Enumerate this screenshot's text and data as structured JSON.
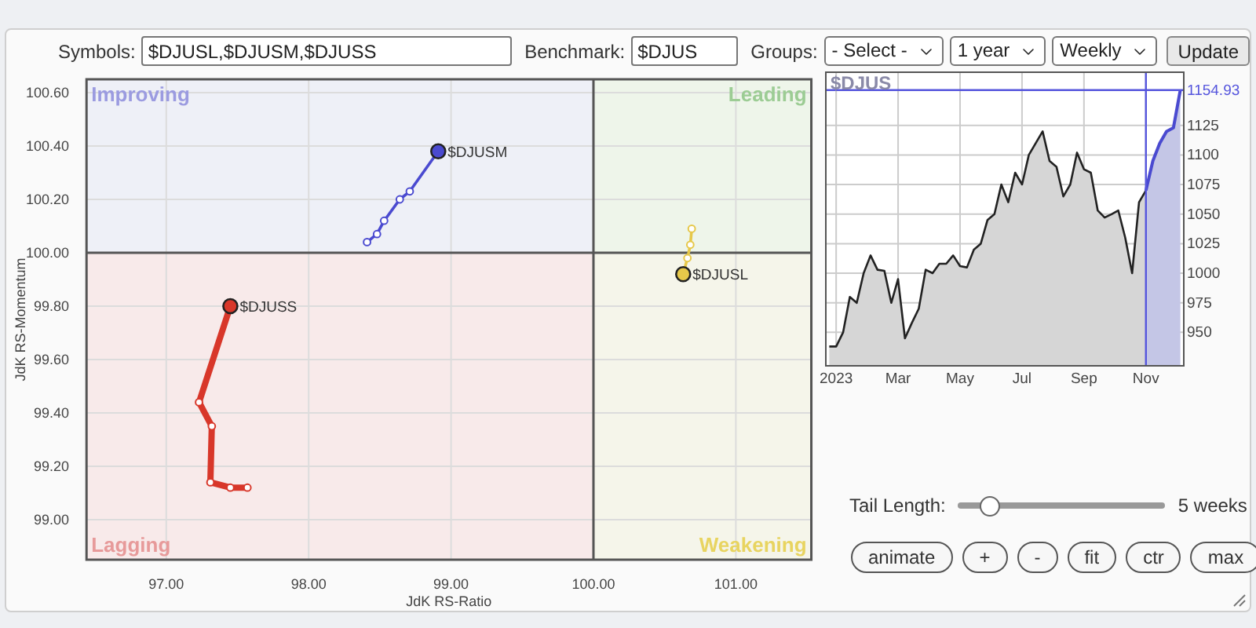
{
  "toolbar": {
    "symbols_label": "Symbols:",
    "symbols_value": "$DJUSL,$DJUSM,$DJUSS",
    "benchmark_label": "Benchmark:",
    "benchmark_value": "$DJUS",
    "groups_label": "Groups:",
    "selects": [
      "- Select -",
      "1 year",
      "Weekly"
    ],
    "update_button": "Update"
  },
  "rrg": {
    "quadrants": [
      {
        "label": "Improving",
        "color": "#9b9be0"
      },
      {
        "label": "Leading",
        "color": "#9ccc94"
      },
      {
        "label": "Lagging",
        "color": "#e79a9a"
      },
      {
        "label": "Weakening",
        "color": "#e8d460"
      }
    ],
    "chart_data": {
      "type": "line",
      "grid": true,
      "xlabel": "JdK RS-Ratio",
      "ylabel": "JdK RS-Momentum",
      "xlim": [
        96.44,
        101.53
      ],
      "ylim": [
        98.85,
        100.65
      ],
      "xticks": [
        {
          "value": 97,
          "label": "97.00"
        },
        {
          "value": 98,
          "label": "98.00"
        },
        {
          "value": 99,
          "label": "99.00"
        },
        {
          "value": 100,
          "label": "100.00"
        },
        {
          "value": 101,
          "label": "101.00"
        }
      ],
      "yticks": [
        {
          "value": 99,
          "label": "99.00"
        },
        {
          "value": 99.2,
          "label": "99.20"
        },
        {
          "value": 99.4,
          "label": "99.40"
        },
        {
          "value": 99.6,
          "label": "99.60"
        },
        {
          "value": 99.8,
          "label": "99.80"
        },
        {
          "value": 100,
          "label": "100.00"
        },
        {
          "value": 100.2,
          "label": "100.20"
        },
        {
          "value": 100.4,
          "label": "100.40"
        },
        {
          "value": 100.6,
          "label": "100.60"
        }
      ],
      "series": [
        {
          "name": "$DJUSL",
          "color": "#e6c84a",
          "marker": "circle",
          "x": [
            100.69,
            100.68,
            100.66,
            100.63
          ],
          "values": [
            100.09,
            100.03,
            99.98,
            99.92
          ]
        },
        {
          "name": "$DJUSM",
          "color": "#4a4ad0",
          "marker": "circle",
          "x": [
            98.41,
            98.48,
            98.53,
            98.64,
            98.71,
            98.91
          ],
          "values": [
            100.04,
            100.07,
            100.12,
            100.2,
            100.23,
            100.38
          ]
        },
        {
          "name": "$DJUSS",
          "color": "#d8372a",
          "marker": "circle",
          "x": [
            97.57,
            97.45,
            97.31,
            97.32,
            97.23,
            97.45
          ],
          "values": [
            99.12,
            99.12,
            99.14,
            99.35,
            99.44,
            99.8
          ]
        }
      ]
    }
  },
  "benchmark_chart": {
    "chart_data": {
      "type": "area",
      "title": "$DJUS",
      "grid": true,
      "ylim": [
        921.7,
        1170
      ],
      "yticks": [
        950,
        975,
        1000,
        1025,
        1050,
        1075,
        1100,
        1125
      ],
      "categories": [
        null,
        "2023",
        null,
        null,
        null,
        null,
        null,
        null,
        null,
        null,
        "Mar",
        null,
        null,
        null,
        null,
        null,
        null,
        null,
        null,
        "May",
        null,
        null,
        null,
        null,
        null,
        null,
        null,
        null,
        "Jul",
        null,
        null,
        null,
        null,
        null,
        null,
        null,
        null,
        "Sep",
        null,
        null,
        null,
        null,
        null,
        null,
        null,
        null,
        "Nov",
        null,
        null,
        null,
        null,
        null
      ],
      "series": [
        {
          "color": "#222222",
          "values": [
            938,
            938,
            950,
            980,
            975,
            1000,
            1015,
            1003,
            1002,
            975,
            995,
            945,
            958,
            970,
            1003,
            1000,
            1008,
            1008,
            1015,
            1006,
            1005,
            1020,
            1025,
            1045,
            1050,
            1075,
            1060,
            1085,
            1075,
            1100,
            1110,
            1120,
            1095,
            1090,
            1065,
            1075,
            1102,
            1088,
            1085,
            1053,
            1047,
            1050,
            1053,
            1030,
            1000,
            1060,
            1070,
            null,
            null,
            null,
            null,
            null
          ]
        },
        {
          "color": "#4a4ad0",
          "values": [
            null,
            null,
            null,
            null,
            null,
            null,
            null,
            null,
            null,
            null,
            null,
            null,
            null,
            null,
            null,
            null,
            null,
            null,
            null,
            null,
            null,
            null,
            null,
            null,
            null,
            null,
            null,
            null,
            null,
            null,
            null,
            null,
            null,
            null,
            null,
            null,
            null,
            null,
            null,
            null,
            null,
            null,
            null,
            null,
            null,
            null,
            1070,
            1095,
            1110,
            1120,
            1123,
            1155
          ]
        }
      ],
      "ref_lines": [
        {
          "axis": "x",
          "value": "Nov"
        },
        {
          "axis": "y",
          "value": 1154.93,
          "label": "1154.93"
        }
      ]
    }
  },
  "tail": {
    "label": "Tail Length:",
    "level": 0.15,
    "reading": "5 weeks"
  },
  "buttons": [
    "animate",
    "+",
    "-",
    "fit",
    "ctr",
    "max"
  ]
}
